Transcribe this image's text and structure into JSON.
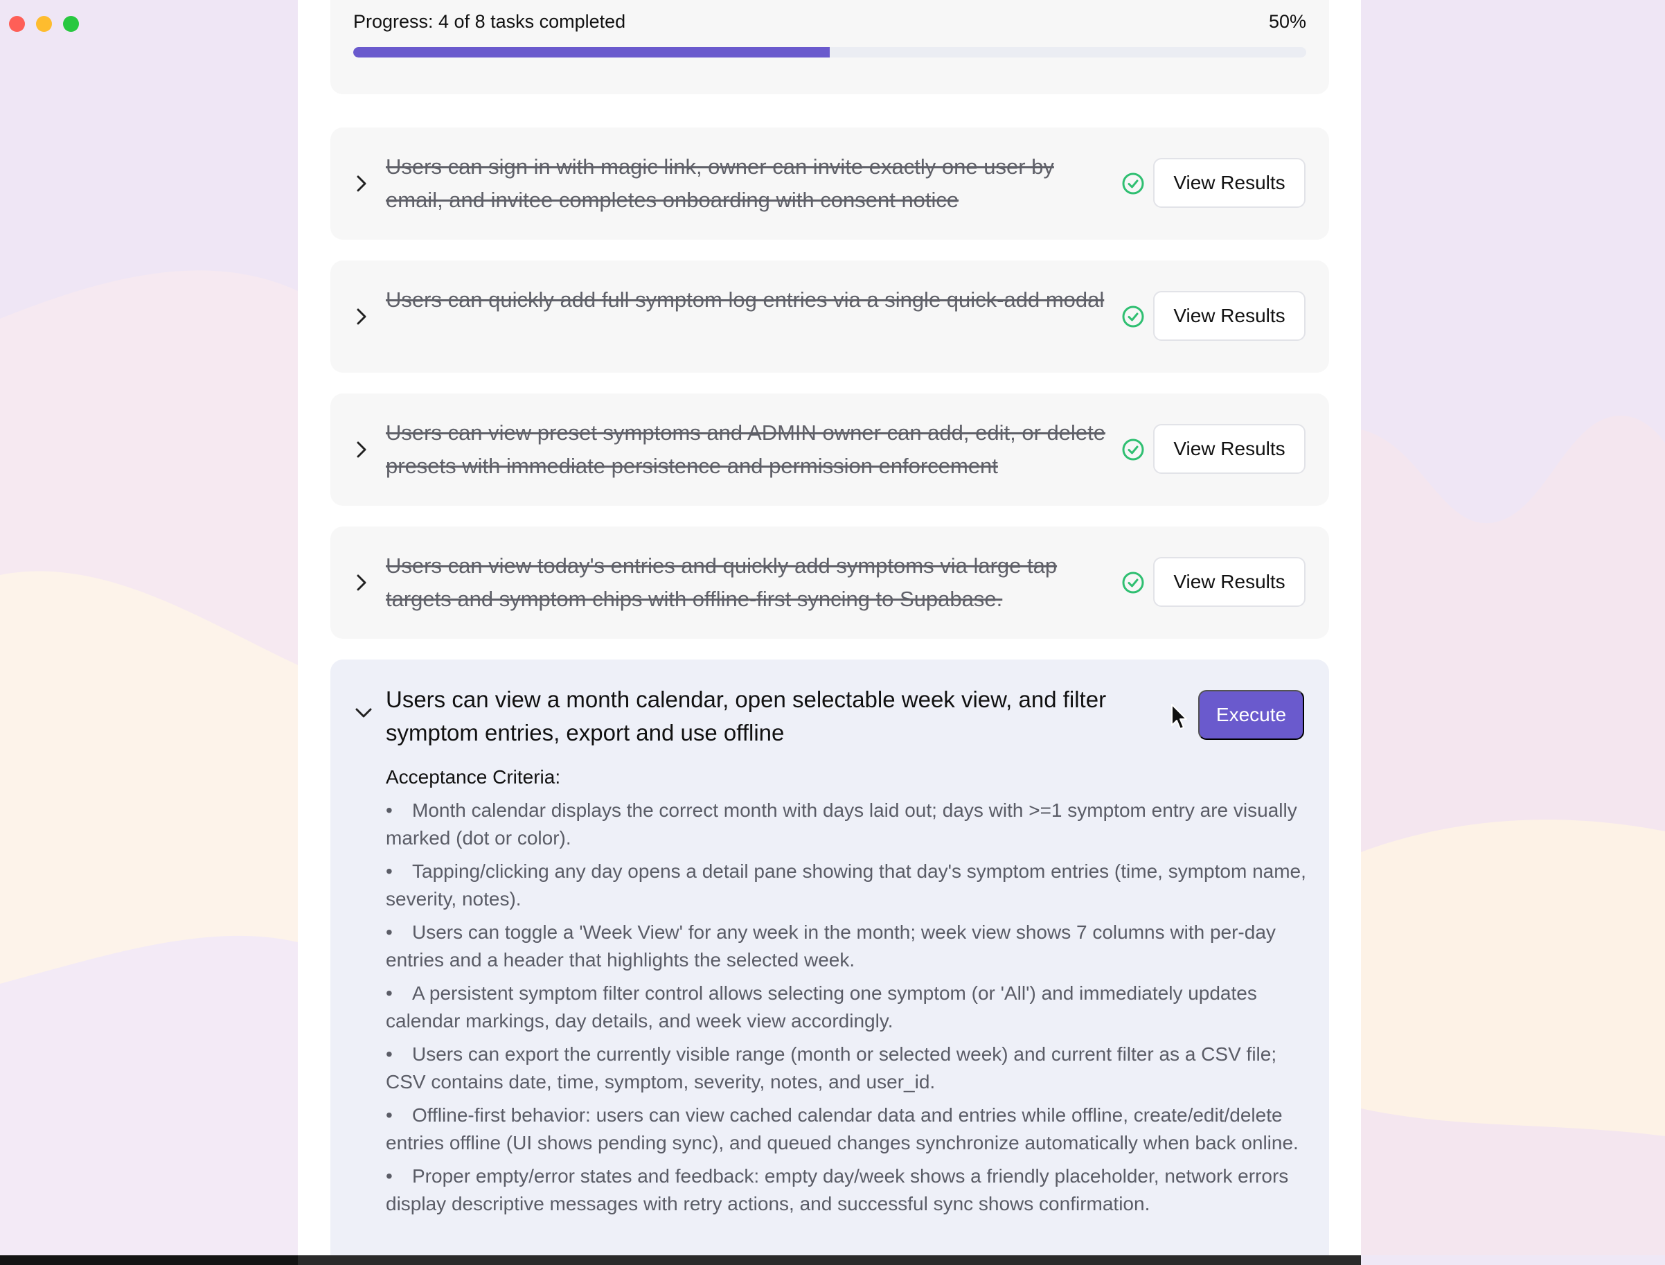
{
  "window": {
    "controls": [
      "close",
      "minimize",
      "zoom"
    ]
  },
  "progress": {
    "label": "Progress: 4 of 8 tasks completed",
    "percent_label": "50%",
    "fraction": 0.5
  },
  "tasks": [
    {
      "text": "Users can sign in with magic link, owner can invite exactly one user by email, and invitee completes onboarding with consent notice",
      "status_icon": "check-circle-icon",
      "button_label": "View Results"
    },
    {
      "text": "Users can quickly add full symptom log entries via a single quick-add modal",
      "status_icon": "check-circle-icon",
      "button_label": "View Results"
    },
    {
      "text": "Users can view preset symptoms and ADMIN owner can add, edit, or delete presets with immediate persistence and permission enforcement",
      "status_icon": "check-circle-icon",
      "button_label": "View Results"
    },
    {
      "text": "Users can view today's entries and quickly add symptoms via large tap targets and symptom chips with offline-first syncing to Supabase.",
      "status_icon": "check-circle-icon",
      "button_label": "View Results"
    }
  ],
  "active_task": {
    "title": "Users can view a month calendar, open selectable week view, and filter symptom entries, export and use offline",
    "button_label": "Execute",
    "criteria_heading": "Acceptance Criteria:",
    "criteria": [
      "Month calendar displays the correct month with days laid out; days with >=1 symptom entry are visually marked (dot or color).",
      "Tapping/clicking any day opens a detail pane showing that day's symptom entries (time, symptom name, severity, notes).",
      "Users can toggle a 'Week View' for any week in the month; week view shows 7 columns with per-day entries and a header that highlights the selected week.",
      "A persistent symptom filter control allows selecting one symptom (or 'All') and immediately updates calendar markings, day details, and week view accordingly.",
      "Users can export the currently visible range (month or selected week) and current filter as a CSV file; CSV contains date, time, symptom, severity, notes, and user_id.",
      "Offline-first behavior: users can view cached calendar data and entries while offline, create/edit/delete entries offline (UI shows pending sync), and queued changes synchronize automatically when back online.",
      "Proper empty/error states and feedback: empty day/week shows a friendly placeholder, network errors display descriptive messages with retry actions, and successful sync shows confirmation."
    ]
  },
  "colors": {
    "accent": "#6a5acd",
    "success": "#2fbf71",
    "card_bg": "#f7f7f7",
    "active_card_bg": "#eef0f8"
  }
}
